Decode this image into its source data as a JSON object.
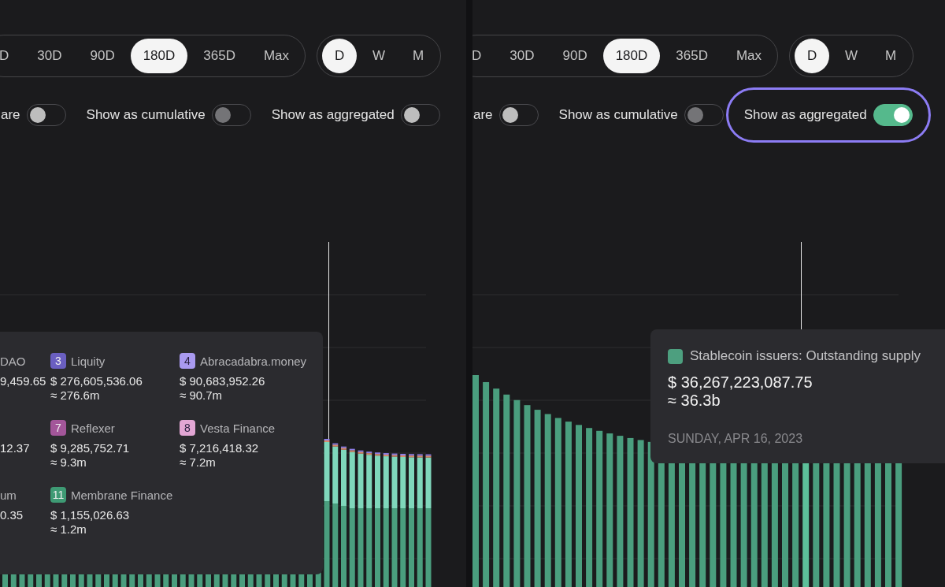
{
  "panels": [
    {
      "range_tabs": [
        {
          "label": "D",
          "selected": false
        },
        {
          "label": "30D",
          "selected": false
        },
        {
          "label": "90D",
          "selected": false
        },
        {
          "label": "180D",
          "selected": true
        },
        {
          "label": "365D",
          "selected": false
        },
        {
          "label": "Max",
          "selected": false
        }
      ],
      "interval_tabs": [
        {
          "label": "D",
          "selected": true
        },
        {
          "label": "W",
          "selected": false
        },
        {
          "label": "M",
          "selected": false
        }
      ],
      "toggles": [
        {
          "label": "are",
          "on": false,
          "disabled": false,
          "highlighted": false
        },
        {
          "label": "Show as cumulative",
          "on": false,
          "disabled": true,
          "highlighted": false
        },
        {
          "label": "Show as aggregated",
          "on": false,
          "disabled": false,
          "highlighted": false
        }
      ],
      "tooltip": {
        "kind": "breakdown",
        "entries": [
          {
            "name": "DAO",
            "value": "9,459.65"
          },
          {
            "number": "3",
            "color": "#6a5fc1",
            "name": "Liquity",
            "value": "$ 276,605,536.06",
            "approx": "≈ 276.6m"
          },
          {
            "number": "4",
            "color": "#a99af0",
            "name": "Abracadabra.money",
            "value": "$ 90,683,952.26",
            "approx": "≈ 90.7m"
          },
          {
            "value": "12.37"
          },
          {
            "number": "7",
            "color": "#a3569a",
            "name": "Reflexer",
            "value": "$ 9,285,752.71",
            "approx": "≈ 9.3m"
          },
          {
            "number": "8",
            "color": "#e2a6d4",
            "name": "Vesta Finance",
            "value": "$ 7,216,418.32",
            "approx": "≈ 7.2m"
          },
          {
            "name": "um",
            "value": "0.35"
          },
          {
            "number": "11",
            "color": "#3e9a74",
            "name": "Membrane Finance",
            "value": "$ 1,155,026.63",
            "approx": "≈ 1.2m"
          }
        ]
      }
    },
    {
      "range_tabs": [
        {
          "label": "D",
          "selected": false
        },
        {
          "label": "30D",
          "selected": false
        },
        {
          "label": "90D",
          "selected": false
        },
        {
          "label": "180D",
          "selected": true
        },
        {
          "label": "365D",
          "selected": false
        },
        {
          "label": "Max",
          "selected": false
        }
      ],
      "interval_tabs": [
        {
          "label": "D",
          "selected": true
        },
        {
          "label": "W",
          "selected": false
        },
        {
          "label": "M",
          "selected": false
        }
      ],
      "toggles": [
        {
          "label": "are",
          "on": false,
          "disabled": false,
          "highlighted": false
        },
        {
          "label": "Show as cumulative",
          "on": false,
          "disabled": true,
          "highlighted": false
        },
        {
          "label": "Show as aggregated",
          "on": true,
          "disabled": false,
          "highlighted": true
        }
      ],
      "tooltip": {
        "kind": "total",
        "color": "#4d9f7f",
        "title": "Stablecoin issuers: Outstanding supply",
        "value": "$ 36,267,223,087.75",
        "approx": "≈ 36.3b",
        "date": "SUNDAY, APR 16, 2023"
      }
    }
  ]
}
